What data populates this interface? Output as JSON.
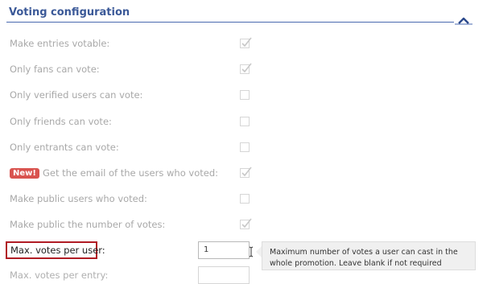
{
  "section": {
    "title": "Voting configuration",
    "collapse_icon": "chevron-up-icon"
  },
  "options": [
    {
      "label": "Make entries votable:",
      "checked": true
    },
    {
      "label": "Only fans can vote:",
      "checked": true
    },
    {
      "label": "Only verified users can vote:",
      "checked": false
    },
    {
      "label": "Only friends can vote:",
      "checked": false
    },
    {
      "label": "Only entrants can vote:",
      "checked": false
    },
    {
      "label": "Get the email of the users who voted:",
      "checked": true,
      "badge": "New!"
    },
    {
      "label": "Make public users who voted:",
      "checked": false
    },
    {
      "label": "Make public the number of votes:",
      "checked": true
    }
  ],
  "max_votes_per_user": {
    "label": "Max. votes per user:",
    "value": "1",
    "tooltip": "Maximum number of votes a user can cast in the whole promotion. Leave blank if not required"
  },
  "max_votes_per_entry": {
    "label": "Max. votes per entry:",
    "value": ""
  },
  "colors": {
    "header": "#3b5998",
    "highlight_border": "#b01c24",
    "badge": "#d9534f"
  }
}
